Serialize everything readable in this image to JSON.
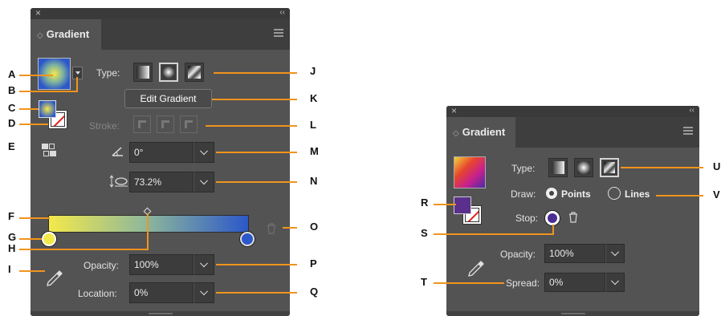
{
  "left_panel": {
    "title_close": "×",
    "title_collapse": "‹‹",
    "tab_label": "Gradient",
    "type_label": "Type:",
    "edit_button": "Edit Gradient",
    "stroke_label": "Stroke:",
    "angle_value": "0°",
    "aspect_value": "73.2%",
    "opacity_label": "Opacity:",
    "opacity_value": "100%",
    "location_label": "Location:",
    "location_value": "0%",
    "selected_type": "radial",
    "gradient_colors": [
      "#f4e94a",
      "#2c58c9"
    ]
  },
  "right_panel": {
    "title_close": "×",
    "title_collapse": "‹‹",
    "tab_label": "Gradient",
    "type_label": "Type:",
    "draw_label": "Draw:",
    "draw_points": "Points",
    "draw_lines": "Lines",
    "draw_selected": "Points",
    "stop_label": "Stop:",
    "opacity_label": "Opacity:",
    "opacity_value": "100%",
    "spread_label": "Spread:",
    "spread_value": "0%",
    "selected_type": "freeform"
  },
  "callouts": {
    "A": "A",
    "B": "B",
    "C": "C",
    "D": "D",
    "E": "E",
    "F": "F",
    "G": "G",
    "H": "H",
    "I": "I",
    "J": "J",
    "K": "K",
    "L": "L",
    "M": "M",
    "N": "N",
    "O": "O",
    "P": "P",
    "Q": "Q",
    "R": "R",
    "S": "S",
    "T": "T",
    "U": "U",
    "V": "V"
  },
  "colors": {
    "callout": "#f0941d",
    "panel": "#535353",
    "accent_stop": "#2c58c9"
  }
}
